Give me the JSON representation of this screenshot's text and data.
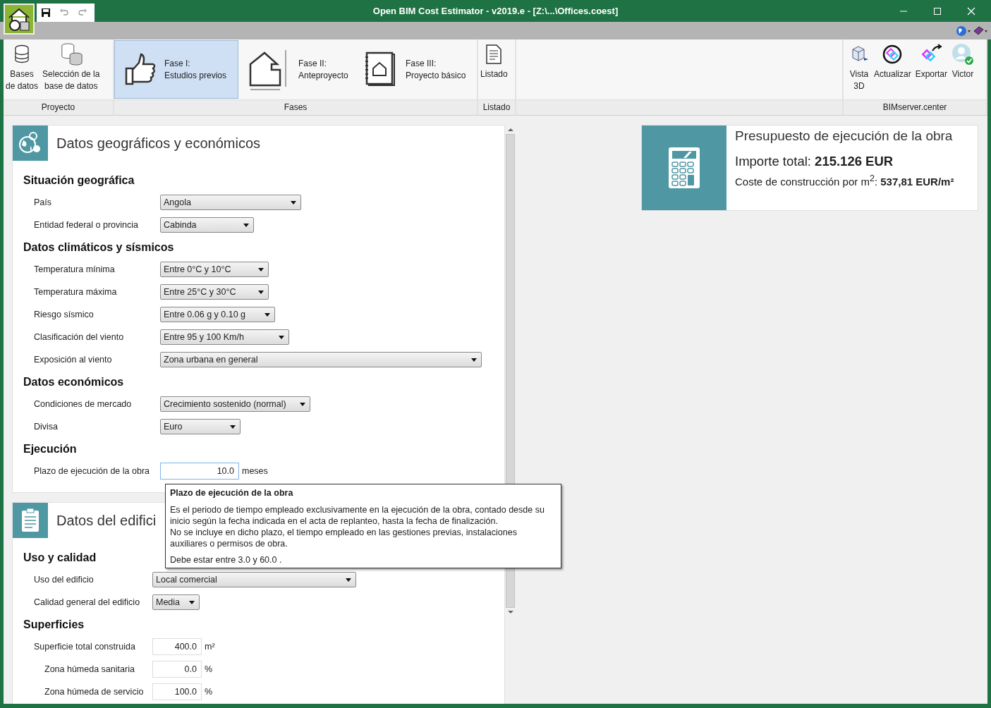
{
  "window": {
    "title": "Open BIM Cost Estimator - v2019.e - [Z:\\...\\Offices.coest]"
  },
  "ribbon": {
    "groups": [
      {
        "label": "Proyecto",
        "buttons": [
          {
            "kind": "tool",
            "lines": [
              "Bases",
              "de datos"
            ]
          },
          {
            "kind": "tool",
            "lines": [
              "Selección de la",
              "base de datos"
            ]
          }
        ]
      },
      {
        "label": "Fases",
        "buttons": [
          {
            "kind": "phase",
            "lines": [
              "Fase I:",
              "Estudios previos"
            ],
            "selected": true
          },
          {
            "kind": "phase",
            "lines": [
              "Fase II:",
              "Anteproyecto"
            ],
            "selected": false
          },
          {
            "kind": "phase",
            "lines": [
              "Fase III:",
              "Proyecto básico"
            ],
            "selected": false
          }
        ]
      },
      {
        "label": "Listado",
        "buttons": [
          {
            "kind": "tool",
            "lines": [
              "Listado"
            ]
          }
        ]
      },
      {
        "label": "BIMserver.center",
        "buttons": [
          {
            "kind": "tool",
            "lines": [
              "Vista",
              "3D"
            ]
          },
          {
            "kind": "tool",
            "lines": [
              "Actualizar"
            ]
          },
          {
            "kind": "tool",
            "lines": [
              "Exportar"
            ]
          },
          {
            "kind": "tool",
            "lines": [
              "Victor"
            ]
          }
        ]
      }
    ]
  },
  "panels": [
    {
      "title": "Datos geográficos y económicos",
      "sections": [
        {
          "heading": "Situación geográfica",
          "fields": [
            {
              "label": "País",
              "kind": "select",
              "value": "Angola"
            },
            {
              "label": "Entidad federal o provincia",
              "kind": "select",
              "value": "Cabinda"
            }
          ]
        },
        {
          "heading": "Datos climáticos y sísmicos",
          "fields": [
            {
              "label": "Temperatura mínima",
              "kind": "select",
              "value": "Entre 0°C y 10°C"
            },
            {
              "label": "Temperatura máxima",
              "kind": "select",
              "value": "Entre 25°C y 30°C"
            },
            {
              "label": "Riesgo sísmico",
              "kind": "select",
              "value": "Entre 0.06 g y 0.10 g"
            },
            {
              "label": "Clasificación del viento",
              "kind": "select",
              "value": "Entre 95 y 100 Km/h"
            },
            {
              "label": "Exposición al viento",
              "kind": "select",
              "value": "Zona urbana en general"
            }
          ]
        },
        {
          "heading": "Datos económicos",
          "fields": [
            {
              "label": "Condiciones de mercado",
              "kind": "select",
              "value": "Crecimiento sostenido (normal)"
            },
            {
              "label": "Divisa",
              "kind": "select",
              "value": "Euro"
            }
          ]
        },
        {
          "heading": "Ejecución",
          "fields": [
            {
              "label": "Plazo de ejecución de la obra",
              "kind": "number",
              "value": "10.0",
              "unit": "meses",
              "focused": true
            }
          ]
        }
      ]
    },
    {
      "title": "Datos del edifici",
      "sections": [
        {
          "heading": "Uso y calidad",
          "fields": [
            {
              "label": "Uso del edificio",
              "kind": "select",
              "value": "Local comercial"
            },
            {
              "label": "Calidad general del edificio",
              "kind": "select",
              "value": "Media"
            }
          ]
        },
        {
          "heading": "Superficies",
          "fields": [
            {
              "label": "Superficie total construida",
              "kind": "number",
              "value": "400.0",
              "unit": "m²",
              "focused": false,
              "children": [
                {
                  "label": "Zona húmeda sanitaria",
                  "kind": "number",
                  "value": "0.0",
                  "unit": "%",
                  "focused": false
                },
                {
                  "label": "Zona húmeda de servicio",
                  "kind": "number",
                  "value": "100.0",
                  "unit": "%",
                  "focused": false
                }
              ]
            }
          ]
        }
      ]
    }
  ],
  "tooltip": {
    "title": "Plazo de ejecución de la obra",
    "paragraphs": [
      "Es el periodo de tiempo empleado exclusivamente en la ejecución de la obra, contado desde su inicio según la fecha indicada en el acta de replanteo, hasta la fecha de finalización.",
      "No se incluye en dicho plazo, el tiempo empleado en las gestiones previas, instalaciones auxiliares o permisos de obra."
    ],
    "range": "Debe estar entre 3.0  y 60.0 ."
  },
  "summary": {
    "title": "Presupuesto de ejecución de la obra",
    "total": "Importe total: **215.126 EUR**",
    "unit_cost": "Coste de construcción por m$^{2}$: **537,81 EUR/m²**"
  }
}
